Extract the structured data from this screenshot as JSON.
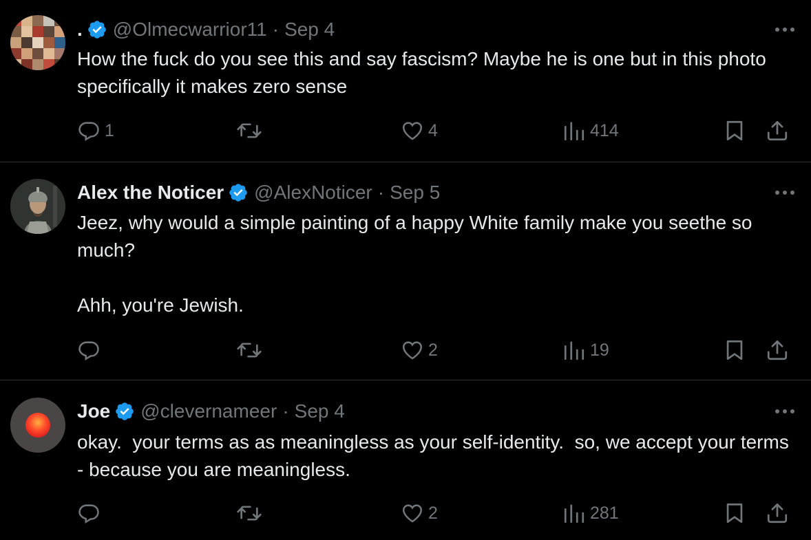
{
  "tweets": [
    {
      "display_name": ".",
      "handle": "@Olmecwarrior11",
      "separator": "·",
      "date": "Sep 4",
      "verified": true,
      "avatar": "avatar-mosaic",
      "text": [
        "How the fuck do you see this and say fascism? Maybe he is one but in this photo specifically it makes zero sense"
      ],
      "replies": "1",
      "retweets": "",
      "likes": "4",
      "views": "414"
    },
    {
      "display_name": "Alex the Noticer",
      "handle": "@AlexNoticer",
      "separator": "·",
      "date": "Sep 5",
      "verified": true,
      "avatar": "avatar-knight",
      "text": [
        "Jeez, why would a simple painting of a happy White family make you seethe so much?",
        "",
        "Ahh, you're Jewish."
      ],
      "replies": "",
      "retweets": "",
      "likes": "2",
      "views": "19"
    },
    {
      "display_name": "Joe",
      "handle": "@clevernameer",
      "separator": "·",
      "date": "Sep 4",
      "verified": true,
      "avatar": "avatar-red-circle",
      "text": [
        "okay.  your terms as as meaningless as your self-identity.  so, we accept your terms - because you are meaningless."
      ],
      "replies": "",
      "retweets": "",
      "likes": "2",
      "views": "281"
    }
  ],
  "icons": {
    "reply": "reply-icon",
    "retweet": "retweet-icon",
    "like": "heart-icon",
    "views": "views-icon",
    "bookmark": "bookmark-icon",
    "share": "share-icon",
    "more": "more-icon",
    "verified": "verified-badge-icon"
  },
  "colors": {
    "background": "#000000",
    "text": "#e7e9ea",
    "muted": "#71767b",
    "divider": "#2f3336",
    "verified": "#1d9bf0"
  }
}
